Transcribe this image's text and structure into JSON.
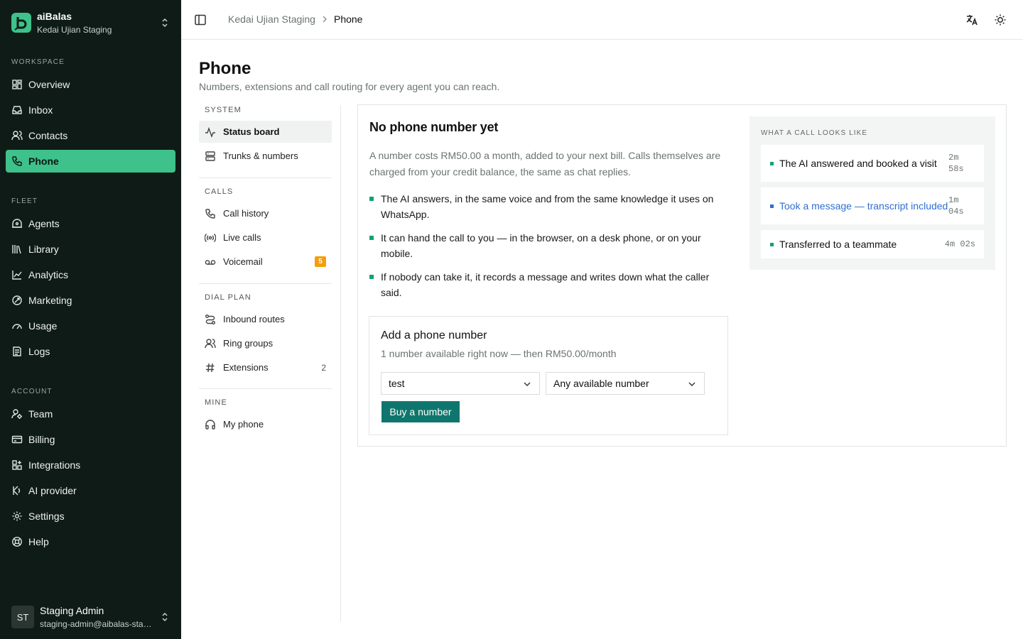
{
  "workspace": {
    "name": "aiBalas",
    "store": "Kedai Ujian Staging"
  },
  "sidebar": {
    "sections": {
      "workspace": "WORKSPACE",
      "fleet": "FLEET",
      "account": "ACCOUNT"
    },
    "workspace_items": [
      {
        "label": "Overview",
        "icon": "grid-icon"
      },
      {
        "label": "Inbox",
        "icon": "inbox-icon"
      },
      {
        "label": "Contacts",
        "icon": "contacts-icon"
      },
      {
        "label": "Phone",
        "icon": "phone-icon",
        "active": true
      }
    ],
    "fleet_items": [
      {
        "label": "Agents",
        "icon": "robot-icon"
      },
      {
        "label": "Library",
        "icon": "library-icon"
      },
      {
        "label": "Analytics",
        "icon": "chart-icon"
      },
      {
        "label": "Marketing",
        "icon": "megaphone-icon"
      },
      {
        "label": "Usage",
        "icon": "gauge-icon"
      },
      {
        "label": "Logs",
        "icon": "logs-icon"
      }
    ],
    "account_items": [
      {
        "label": "Team",
        "icon": "team-icon"
      },
      {
        "label": "Billing",
        "icon": "card-icon"
      },
      {
        "label": "Integrations",
        "icon": "puzzle-icon"
      },
      {
        "label": "AI provider",
        "icon": "ai-icon"
      },
      {
        "label": "Settings",
        "icon": "gear-icon"
      },
      {
        "label": "Help",
        "icon": "lifebuoy-icon"
      }
    ]
  },
  "user": {
    "initials": "ST",
    "name": "Staging Admin",
    "email": "staging-admin@aibalas-staging.test"
  },
  "topbar": {
    "crumb_parent": "Kedai Ujian Staging",
    "crumb_current": "Phone"
  },
  "page": {
    "title": "Phone",
    "subtitle": "Numbers, extensions and call routing for every agent you can reach."
  },
  "subnav": {
    "system_label": "SYSTEM",
    "system": [
      {
        "label": "Status board",
        "active": true
      },
      {
        "label": "Trunks & numbers"
      }
    ],
    "calls_label": "CALLS",
    "calls": [
      {
        "label": "Call history"
      },
      {
        "label": "Live calls"
      },
      {
        "label": "Voicemail",
        "badge": "5"
      }
    ],
    "dialplan_label": "DIAL PLAN",
    "dialplan": [
      {
        "label": "Inbound routes"
      },
      {
        "label": "Ring groups"
      },
      {
        "label": "Extensions",
        "count": "2"
      }
    ],
    "mine_label": "MINE",
    "mine": [
      {
        "label": "My phone"
      }
    ]
  },
  "card": {
    "title": "No phone number yet",
    "description": "A number costs RM50.00 a month, added to your next bill. Calls themselves are charged from your credit balance, the same as chat replies.",
    "bullets": [
      "The AI answers, in the same voice and from the same knowledge it uses on WhatsApp.",
      "It can hand the call to you — in the browser, on a desk phone, or on your mobile.",
      "If nobody can take it, it records a message and writes down what the caller said."
    ],
    "add": {
      "title": "Add a phone number",
      "subtitle": "1 number available right now — then RM50.00/month",
      "country_value": "test",
      "number_value": "Any available number",
      "buy_label": "Buy a number"
    },
    "examples": {
      "label": "WHAT A CALL LOOKS LIKE",
      "rows": [
        {
          "text": "The AI answered and booked a visit",
          "dur1": "2m",
          "dur2": "58s"
        },
        {
          "text": "Took a message — transcript included",
          "dur1": "1m",
          "dur2": "04s"
        },
        {
          "text": "Transferred to a teammate",
          "dur1": "4m 02s",
          "dur2": ""
        }
      ]
    }
  },
  "colors": {
    "sidebar_bg": "#0f1b17",
    "accent": "#3ec18a",
    "primary_button": "#0f766e",
    "link": "#2f6fd1",
    "badge": "#f59e0b"
  }
}
